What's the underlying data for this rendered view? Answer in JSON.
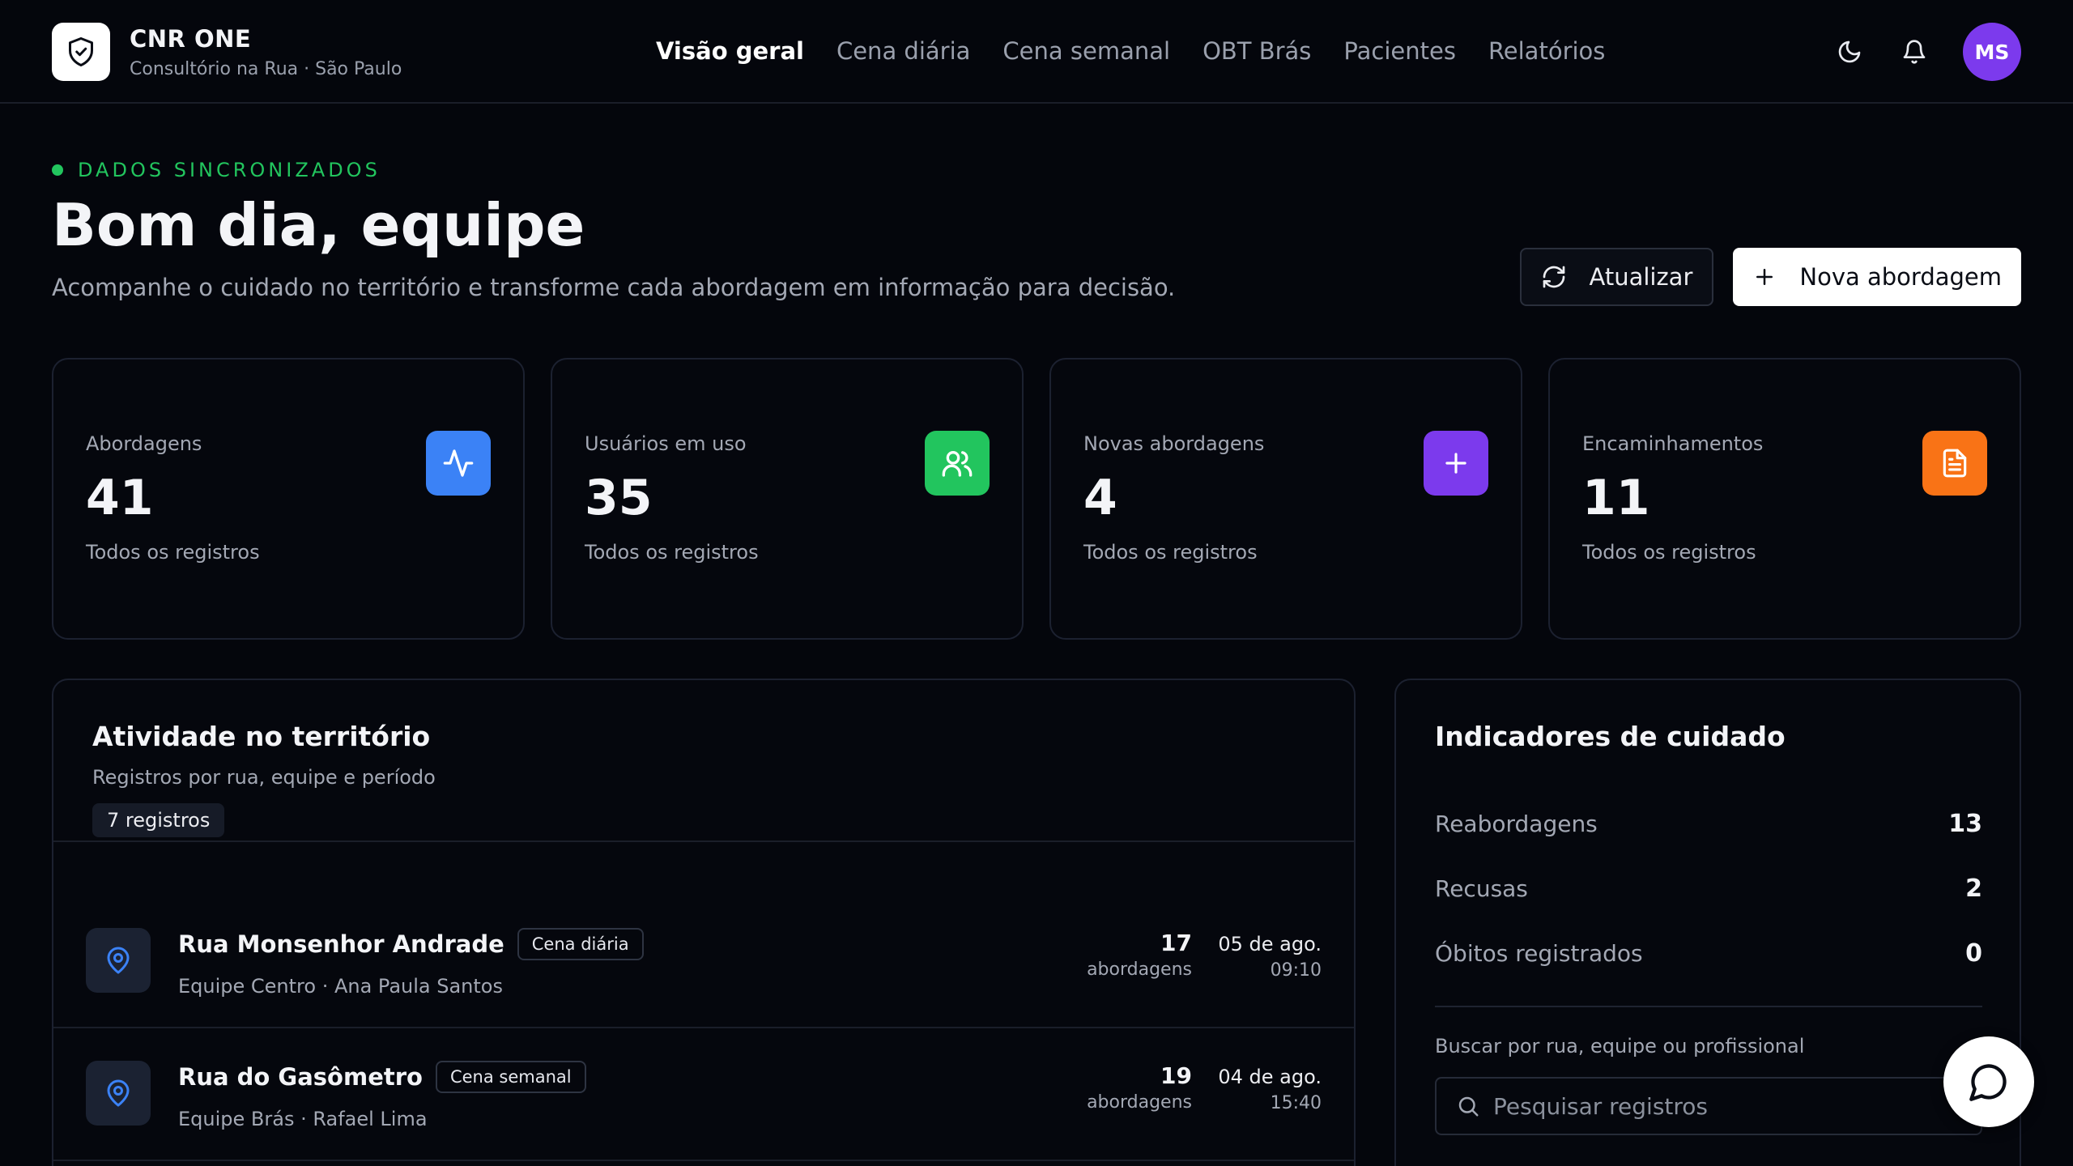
{
  "brand": {
    "name": "CNR ONE",
    "subtitle": "Consultório na Rua · São Paulo"
  },
  "nav": [
    {
      "label": "Visão geral",
      "active": true
    },
    {
      "label": "Cena diária",
      "active": false
    },
    {
      "label": "Cena semanal",
      "active": false
    },
    {
      "label": "OBT Brás",
      "active": false
    },
    {
      "label": "Pacientes",
      "active": false
    },
    {
      "label": "Relatórios",
      "active": false
    }
  ],
  "header": {
    "avatar_initials": "MS",
    "icons": [
      "moon-icon",
      "bell-icon"
    ]
  },
  "hero": {
    "status": "DADOS SINCRONIZADOS",
    "title": "Bom dia, equipe",
    "subtitle": "Acompanhe o cuidado no território e transforme cada abordagem em informação para decisão.",
    "refresh_label": "Atualizar",
    "new_label": "Nova abordagem"
  },
  "stats": [
    {
      "label": "Abordagens",
      "value": "41",
      "foot": "Todos os registros",
      "icon": "activity-icon",
      "color": "#3b82f6"
    },
    {
      "label": "Usuários em uso",
      "value": "35",
      "foot": "Todos os registros",
      "icon": "users-icon",
      "color": "#22c55e"
    },
    {
      "label": "Novas abordagens",
      "value": "4",
      "foot": "Todos os registros",
      "icon": "plus-icon",
      "color": "#7c3aed"
    },
    {
      "label": "Encaminhamentos",
      "value": "11",
      "foot": "Todos os registros",
      "icon": "document-icon",
      "color": "#f97316"
    }
  ],
  "activity": {
    "title": "Atividade no território",
    "subtitle": "Registros por rua, equipe e período",
    "count_badge": "7 registros",
    "rows": [
      {
        "street": "Rua Monsenhor Andrade",
        "tag": "Cena diária",
        "meta": "Equipe Centro · Ana Paula Santos",
        "count": "17",
        "count_label": "abordagens",
        "date": "05 de ago.",
        "time": "09:10"
      },
      {
        "street": "Rua do Gasômetro",
        "tag": "Cena semanal",
        "meta": "Equipe Brás · Rafael Lima",
        "count": "19",
        "count_label": "abordagens",
        "date": "04 de ago.",
        "time": "15:40"
      }
    ]
  },
  "indicators": {
    "title": "Indicadores de cuidado",
    "items": [
      {
        "label": "Reabordagens",
        "value": "13"
      },
      {
        "label": "Recusas",
        "value": "2"
      },
      {
        "label": "Óbitos registrados",
        "value": "0"
      }
    ],
    "search_label": "Buscar por rua, equipe ou profissional",
    "search_placeholder": "Pesquisar registros"
  },
  "colors": {
    "accent_green": "#22c55e",
    "pin_blue": "#3b82f6",
    "avatar": "#7c3aed"
  }
}
